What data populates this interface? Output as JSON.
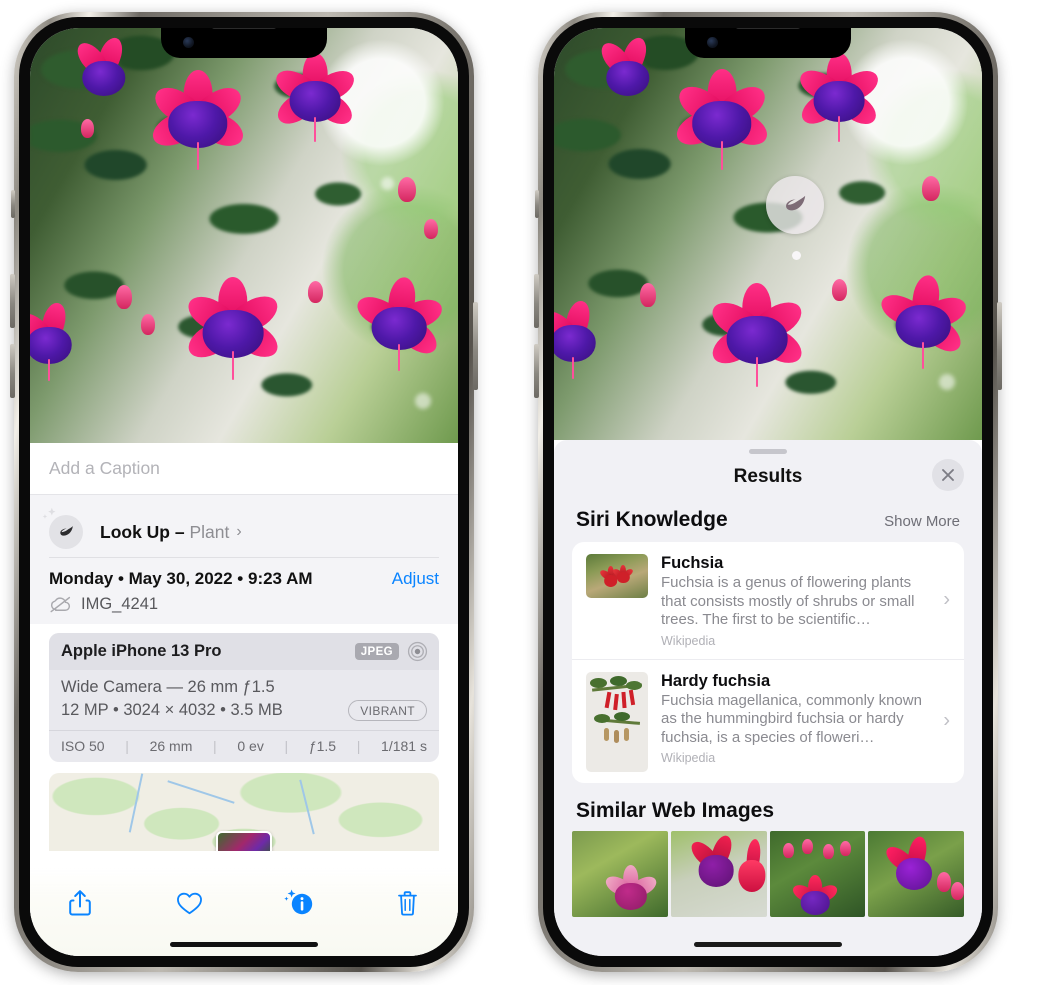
{
  "phones": {
    "left": {
      "name": "iPhone photo detail view",
      "caption_placeholder": "Add a Caption",
      "lookup": {
        "label": "Look Up",
        "dash": " – ",
        "subject": "Plant",
        "icon": "leaf-icon",
        "chevron": "›"
      },
      "meta": {
        "date": "Monday • May 30, 2022 • 9:23 AM",
        "adjust_label": "Adjust",
        "filename": "IMG_4241",
        "cloud_icon": "cloud-slash-icon"
      },
      "exif": {
        "model": "Apple iPhone 13 Pro",
        "format_badge": "JPEG",
        "hdr_icon": "aperture-icon",
        "lens": "Wide Camera — 26 mm ƒ1.5",
        "size": "12 MP • 3024 × 4032 • 3.5 MB",
        "style_badge": "VIBRANT",
        "stats": [
          "ISO 50",
          "26 mm",
          "0 ev",
          "ƒ1.5",
          "1/181 s"
        ]
      },
      "toolbar": [
        {
          "name": "share-button",
          "icon": "share-icon"
        },
        {
          "name": "favorite-button",
          "icon": "heart-icon"
        },
        {
          "name": "info-button",
          "icon": "info-sparkle-icon"
        },
        {
          "name": "delete-button",
          "icon": "trash-icon"
        }
      ]
    },
    "right": {
      "name": "Visual Look Up results view",
      "badge_icon": "leaf-icon",
      "sheet": {
        "title": "Results",
        "close_icon": "close-icon"
      },
      "siri_knowledge": {
        "title": "Siri Knowledge",
        "action": "Show More",
        "items": [
          {
            "title": "Fuchsia",
            "description": "Fuchsia is a genus of flowering plants that consists mostly of shrubs or small trees. The first to be scientific…",
            "source": "Wikipedia",
            "chevron": "›"
          },
          {
            "title": "Hardy fuchsia",
            "description": "Fuchsia magellanica, commonly known as the hummingbird fuchsia or hardy fuchsia, is a species of floweri…",
            "source": "Wikipedia",
            "chevron": "›"
          }
        ]
      },
      "similar_web_images": {
        "title": "Similar Web Images",
        "count": 4
      }
    }
  },
  "colors": {
    "accent_blue": "#0a84ff",
    "sheet_bg": "#f1f1f5",
    "card_bg": "#ffffff",
    "secondary_text": "#8e8e93",
    "exif_bg": "#e9e9ee"
  }
}
